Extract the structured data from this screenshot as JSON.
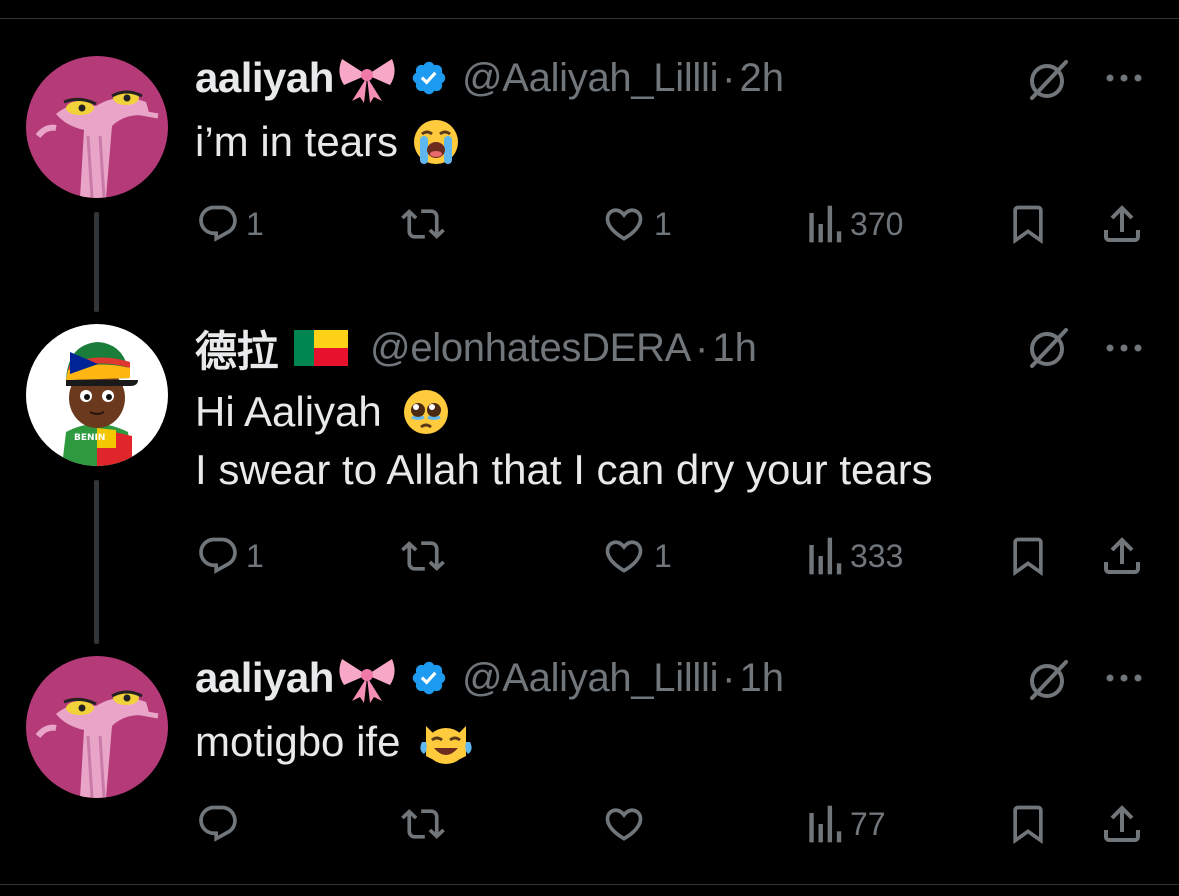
{
  "colors": {
    "background": "#000000",
    "text_primary": "#e7e9ea",
    "text_secondary": "#71767b",
    "verified_badge": "#1d9bf0",
    "divider": "#2f3336"
  },
  "tweets": [
    {
      "display_name": "aaliyah",
      "name_emoji": "ribbon-emoji",
      "verified": true,
      "handle": "@Aaliyah_Lillli",
      "separator": "·",
      "time": "2h",
      "avatar": "pink-panther-avatar",
      "lines": [
        {
          "text": "i’m in tears",
          "emoji": "loudly-crying-face-emoji"
        }
      ],
      "replies": "1",
      "reposts": "",
      "likes": "1",
      "views": "370"
    },
    {
      "display_name": "德拉",
      "name_emoji": "benin-flag-emoji",
      "verified": false,
      "handle": "@elonhatesDERA",
      "separator": "·",
      "time": "1h",
      "avatar": "cartoon-boy-avatar",
      "avatar_text": "BENIN",
      "lines": [
        {
          "text": "Hi Aaliyah",
          "emoji": "pleading-face-emoji"
        },
        {
          "text": "I swear to Allah that I can dry your tears",
          "emoji": ""
        }
      ],
      "replies": "1",
      "reposts": "",
      "likes": "1",
      "views": "333"
    },
    {
      "display_name": "aaliyah",
      "name_emoji": "ribbon-emoji",
      "verified": true,
      "handle": "@Aaliyah_Lillli",
      "separator": "·",
      "time": "1h",
      "avatar": "pink-panther-avatar",
      "lines": [
        {
          "text": "motigbo ife",
          "emoji": "cat-with-tears-of-joy-emoji"
        }
      ],
      "replies": "",
      "reposts": "",
      "likes": "",
      "views": "77"
    }
  ]
}
